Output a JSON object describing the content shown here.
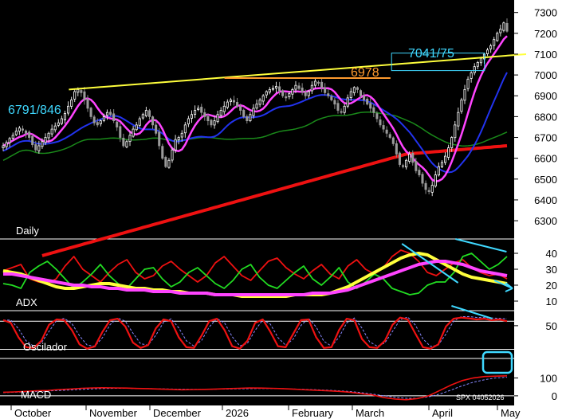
{
  "chart_data": {
    "type": "candlestick-multipanel",
    "ticker_stamp": "SPX 04052026",
    "x_labels": [
      "October",
      "November",
      "December",
      "2026",
      "February",
      "March",
      "April",
      "May"
    ],
    "price_panel": {
      "label": "Daily",
      "ylim": [
        6220,
        7360
      ],
      "ticks": [
        6300,
        6400,
        6500,
        6600,
        6700,
        6800,
        6900,
        7000,
        7100,
        7200,
        7300
      ],
      "annotations": [
        {
          "text": "6791/846",
          "color": "#3fd8ff"
        },
        {
          "text": "6978",
          "color": "#ff9a2e"
        },
        {
          "text": "7041/75",
          "color": "#3fd8ff"
        }
      ],
      "trendline": {
        "color": "#ffff3c",
        "points": [
          [
            0.135,
            6930
          ],
          [
            1.0,
            7100
          ]
        ]
      },
      "resistance_line": {
        "color": "#ff9a2e",
        "value": 6985,
        "range": [
          0.44,
          0.695
        ]
      },
      "box_7041": {
        "color": "#3fd8ff",
        "range": [
          0.705,
          0.895
        ],
        "low": 7041,
        "high": 7075
      },
      "closes": [
        6660,
        6675,
        6695,
        6710,
        6730,
        6745,
        6735,
        6720,
        6700,
        6665,
        6640,
        6660,
        6680,
        6700,
        6720,
        6740,
        6755,
        6770,
        6790,
        6815,
        6850,
        6880,
        6920,
        6930,
        6915,
        6880,
        6840,
        6800,
        6770,
        6760,
        6780,
        6800,
        6820,
        6810,
        6780,
        6750,
        6700,
        6660,
        6680,
        6710,
        6740,
        6760,
        6790,
        6810,
        6830,
        6800,
        6760,
        6720,
        6660,
        6600,
        6560,
        6590,
        6640,
        6690,
        6700,
        6720,
        6760,
        6790,
        6810,
        6830,
        6840,
        6820,
        6800,
        6780,
        6760,
        6780,
        6810,
        6830,
        6850,
        6870,
        6880,
        6870,
        6850,
        6830,
        6800,
        6780,
        6810,
        6840,
        6860,
        6880,
        6900,
        6920,
        6930,
        6935,
        6945,
        6925,
        6900,
        6890,
        6910,
        6930,
        6950,
        6935,
        6920,
        6900,
        6920,
        6950,
        6970,
        6960,
        6940,
        6915,
        6900,
        6880,
        6860,
        6830,
        6820,
        6850,
        6890,
        6920,
        6940,
        6930,
        6900,
        6880,
        6860,
        6840,
        6820,
        6790,
        6760,
        6740,
        6720,
        6700,
        6670,
        6620,
        6570,
        6560,
        6590,
        6620,
        6580,
        6540,
        6520,
        6480,
        6450,
        6440,
        6470,
        6520,
        6560,
        6580,
        6610,
        6650,
        6700,
        6760,
        6820,
        6880,
        6930,
        6980,
        7010,
        7040,
        7060,
        7080,
        7100,
        7120,
        7140,
        7170,
        7200,
        7220,
        7250,
        7210
      ],
      "ma_series": [
        {
          "name": "",
          "color": "#ff44ff",
          "period": 9
        },
        {
          "name": "",
          "color": "#2233ee",
          "period": 20
        },
        {
          "name": "",
          "color": "#1a8a1a",
          "period": 50
        },
        {
          "name": "",
          "color": "#ee1111",
          "period": 200
        }
      ],
      "ma200": [
        6080,
        6620,
        6660
      ]
    },
    "adx_panel": {
      "label": "ADX",
      "ylim": [
        5,
        48
      ],
      "ticks": [
        10,
        20,
        30,
        40
      ],
      "series": [
        {
          "name": "",
          "color": "#ee1111",
          "values": [
            29,
            31,
            33,
            24,
            22,
            21,
            24,
            32,
            38,
            30,
            26,
            22,
            28,
            33,
            36,
            28,
            24,
            26,
            32,
            35,
            30,
            26,
            22,
            26,
            34,
            38,
            32,
            26,
            23,
            29,
            35,
            37,
            31,
            27,
            24,
            29,
            33,
            27,
            24,
            32,
            36,
            30,
            27,
            31,
            38,
            42,
            40,
            35,
            28,
            26,
            30,
            34,
            36,
            31,
            28,
            26,
            27,
            24
          ]
        },
        {
          "name": "",
          "color": "#22dd22",
          "values": [
            21,
            20,
            18,
            28,
            32,
            35,
            30,
            24,
            18,
            22,
            27,
            33,
            26,
            21,
            18,
            24,
            30,
            31,
            24,
            19,
            22,
            28,
            31,
            26,
            21,
            18,
            23,
            30,
            33,
            25,
            20,
            18,
            23,
            28,
            32,
            24,
            20,
            25,
            31,
            22,
            18,
            22,
            27,
            24,
            18,
            16,
            14,
            15,
            20,
            22,
            22,
            28,
            38,
            40,
            35,
            30,
            33,
            38
          ]
        },
        {
          "name": "",
          "color": "#ffff3c",
          "values": [
            29,
            28,
            27,
            25,
            23,
            21,
            19,
            18,
            18,
            19,
            20,
            21,
            21,
            20,
            19,
            18,
            18,
            17,
            17,
            16,
            16,
            15,
            15,
            15,
            14,
            14,
            14,
            13,
            13,
            13,
            13,
            13,
            13,
            14,
            14,
            14,
            14,
            15,
            17,
            19,
            22,
            25,
            28,
            31,
            34,
            37,
            39,
            40,
            39,
            36,
            33,
            30,
            27,
            25,
            24,
            23,
            22,
            21
          ]
        },
        {
          "name": "",
          "color": "#ff44ff",
          "values": [
            27,
            27,
            26,
            25,
            24,
            23,
            22,
            21,
            20,
            20,
            19,
            19,
            18,
            18,
            17,
            17,
            17,
            16,
            16,
            16,
            15,
            15,
            15,
            15,
            14,
            14,
            14,
            14,
            14,
            14,
            14,
            14,
            14,
            14,
            14,
            15,
            15,
            15,
            16,
            17,
            19,
            21,
            23,
            25,
            27,
            29,
            31,
            33,
            34,
            35,
            35,
            34,
            33,
            31,
            29,
            28,
            27,
            26
          ]
        }
      ],
      "downtrends": [
        {
          "from": 0.78,
          "to": 0.89
        },
        {
          "from": 0.885,
          "to": 0.985
        }
      ]
    },
    "oscillator_panel": {
      "label": "Oscilador",
      "ylim": [
        -15,
        110
      ],
      "ticks": [
        50
      ],
      "overbought": 85,
      "oversold": 15,
      "values": [
        88,
        80,
        40,
        12,
        10,
        30,
        75,
        90,
        88,
        60,
        20,
        8,
        14,
        55,
        88,
        92,
        70,
        25,
        10,
        18,
        65,
        90,
        85,
        40,
        12,
        10,
        45,
        85,
        92,
        60,
        15,
        8,
        30,
        80,
        90,
        55,
        15,
        12,
        50,
        88,
        90,
        40,
        10,
        12,
        60,
        92,
        88,
        35,
        12,
        10,
        30,
        75,
        95,
        90,
        50,
        12,
        8,
        20,
        70,
        92,
        95,
        93,
        90,
        92,
        88,
        90,
        85
      ]
    },
    "macd_panel": {
      "label": "MACD",
      "ylim": [
        -45,
        200
      ],
      "ticks": [
        0,
        100
      ],
      "macd": [
        20,
        22,
        25,
        28,
        30,
        35,
        38,
        42,
        44,
        45,
        44,
        43,
        41,
        40,
        38,
        36,
        34,
        35,
        36,
        38,
        40,
        42,
        44,
        43,
        42,
        40,
        37,
        34,
        31,
        28,
        25,
        20,
        12,
        5,
        -10,
        -18,
        -22,
        -15,
        0,
        30,
        60,
        85,
        100,
        108,
        110,
        112
      ],
      "signal": [
        18,
        20,
        22,
        24,
        27,
        30,
        33,
        36,
        39,
        41,
        42,
        42,
        41,
        40,
        39,
        38,
        37,
        36,
        36,
        37,
        38,
        39,
        40,
        41,
        41,
        40,
        38,
        36,
        34,
        31,
        28,
        24,
        18,
        10,
        0,
        -8,
        -14,
        -14,
        -6,
        10,
        32,
        56,
        76,
        90,
        100,
        104
      ]
    }
  }
}
